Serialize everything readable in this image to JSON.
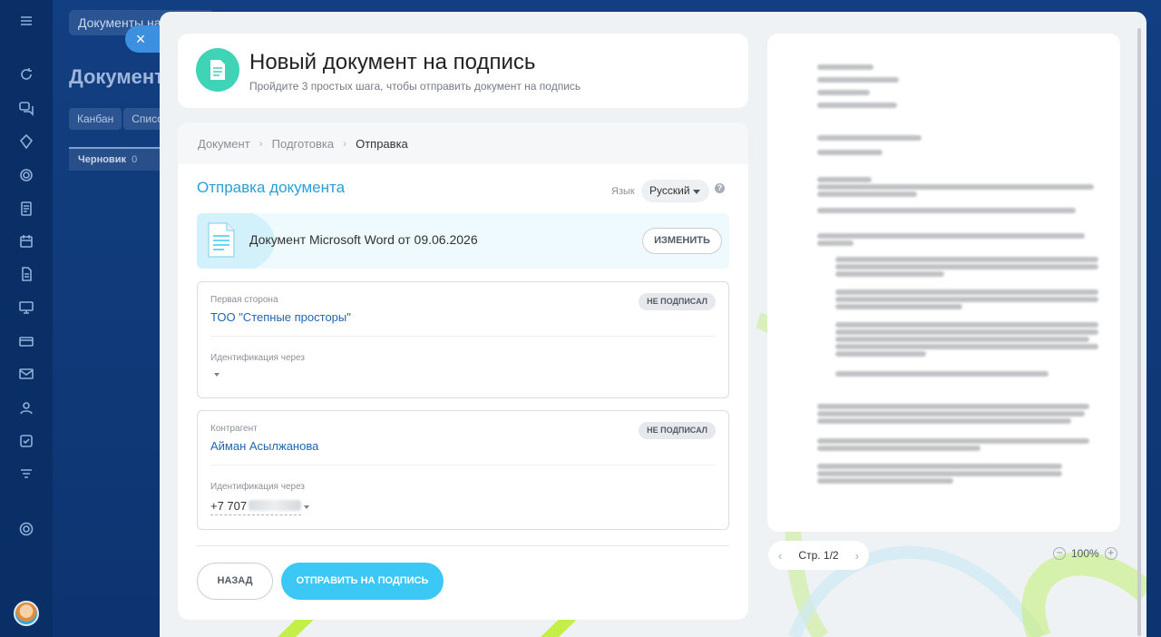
{
  "background": {
    "search_value": "Документы на",
    "page_title": "Документ",
    "tabs": [
      "Канбан",
      "Список"
    ],
    "column": {
      "label": "Черновик",
      "count": "0"
    },
    "close_glyph": "×",
    "rail_icons": [
      "menu-icon",
      "sync-icon",
      "chat-icon",
      "star-icon",
      "circle-icon",
      "document-icon",
      "calendar-icon",
      "file-icon",
      "monitor-icon",
      "card-icon",
      "mail-icon",
      "contacts-icon",
      "checkbox-icon",
      "filter-icon",
      "settings-icon"
    ]
  },
  "header": {
    "title": "Новый документ на подпись",
    "subtitle": "Пройдите 3 простых шага, чтобы отправить документ на подпись"
  },
  "breadcrumbs": [
    "Документ",
    "Подготовка",
    "Отправка"
  ],
  "section": {
    "title": "Отправка документа",
    "language_label": "Язык",
    "language_value": "Русский",
    "help_glyph": "?"
  },
  "document": {
    "name": "Документ Microsoft Word от 09.06.2026",
    "change_label": "ИЗМЕНИТЬ"
  },
  "parties": [
    {
      "role": "Первая сторона",
      "name": "ТОО \"Степные просторы\"",
      "status": "НЕ ПОДПИСАЛ",
      "ident_label": "Идентификация через",
      "ident_value": ""
    },
    {
      "role": "Контрагент",
      "name": "Айман Асылжанова",
      "status": "НЕ ПОДПИСАЛ",
      "ident_label": "Идентификация через",
      "ident_value": "+7 707"
    }
  ],
  "actions": {
    "back_label": "НАЗАД",
    "send_label": "ОТПРАВИТЬ НА ПОДПИСЬ"
  },
  "preview": {
    "page_label": "Стр. 1/2",
    "zoom_value": "100%",
    "prev_glyph": "‹",
    "next_glyph": "›",
    "zoom_out_glyph": "−",
    "zoom_in_glyph": "+"
  },
  "colors": {
    "accent": "#3bc8f5",
    "link": "#2067b0",
    "section_title": "#2a9fd6",
    "header_icon": "#3fd4b6"
  }
}
